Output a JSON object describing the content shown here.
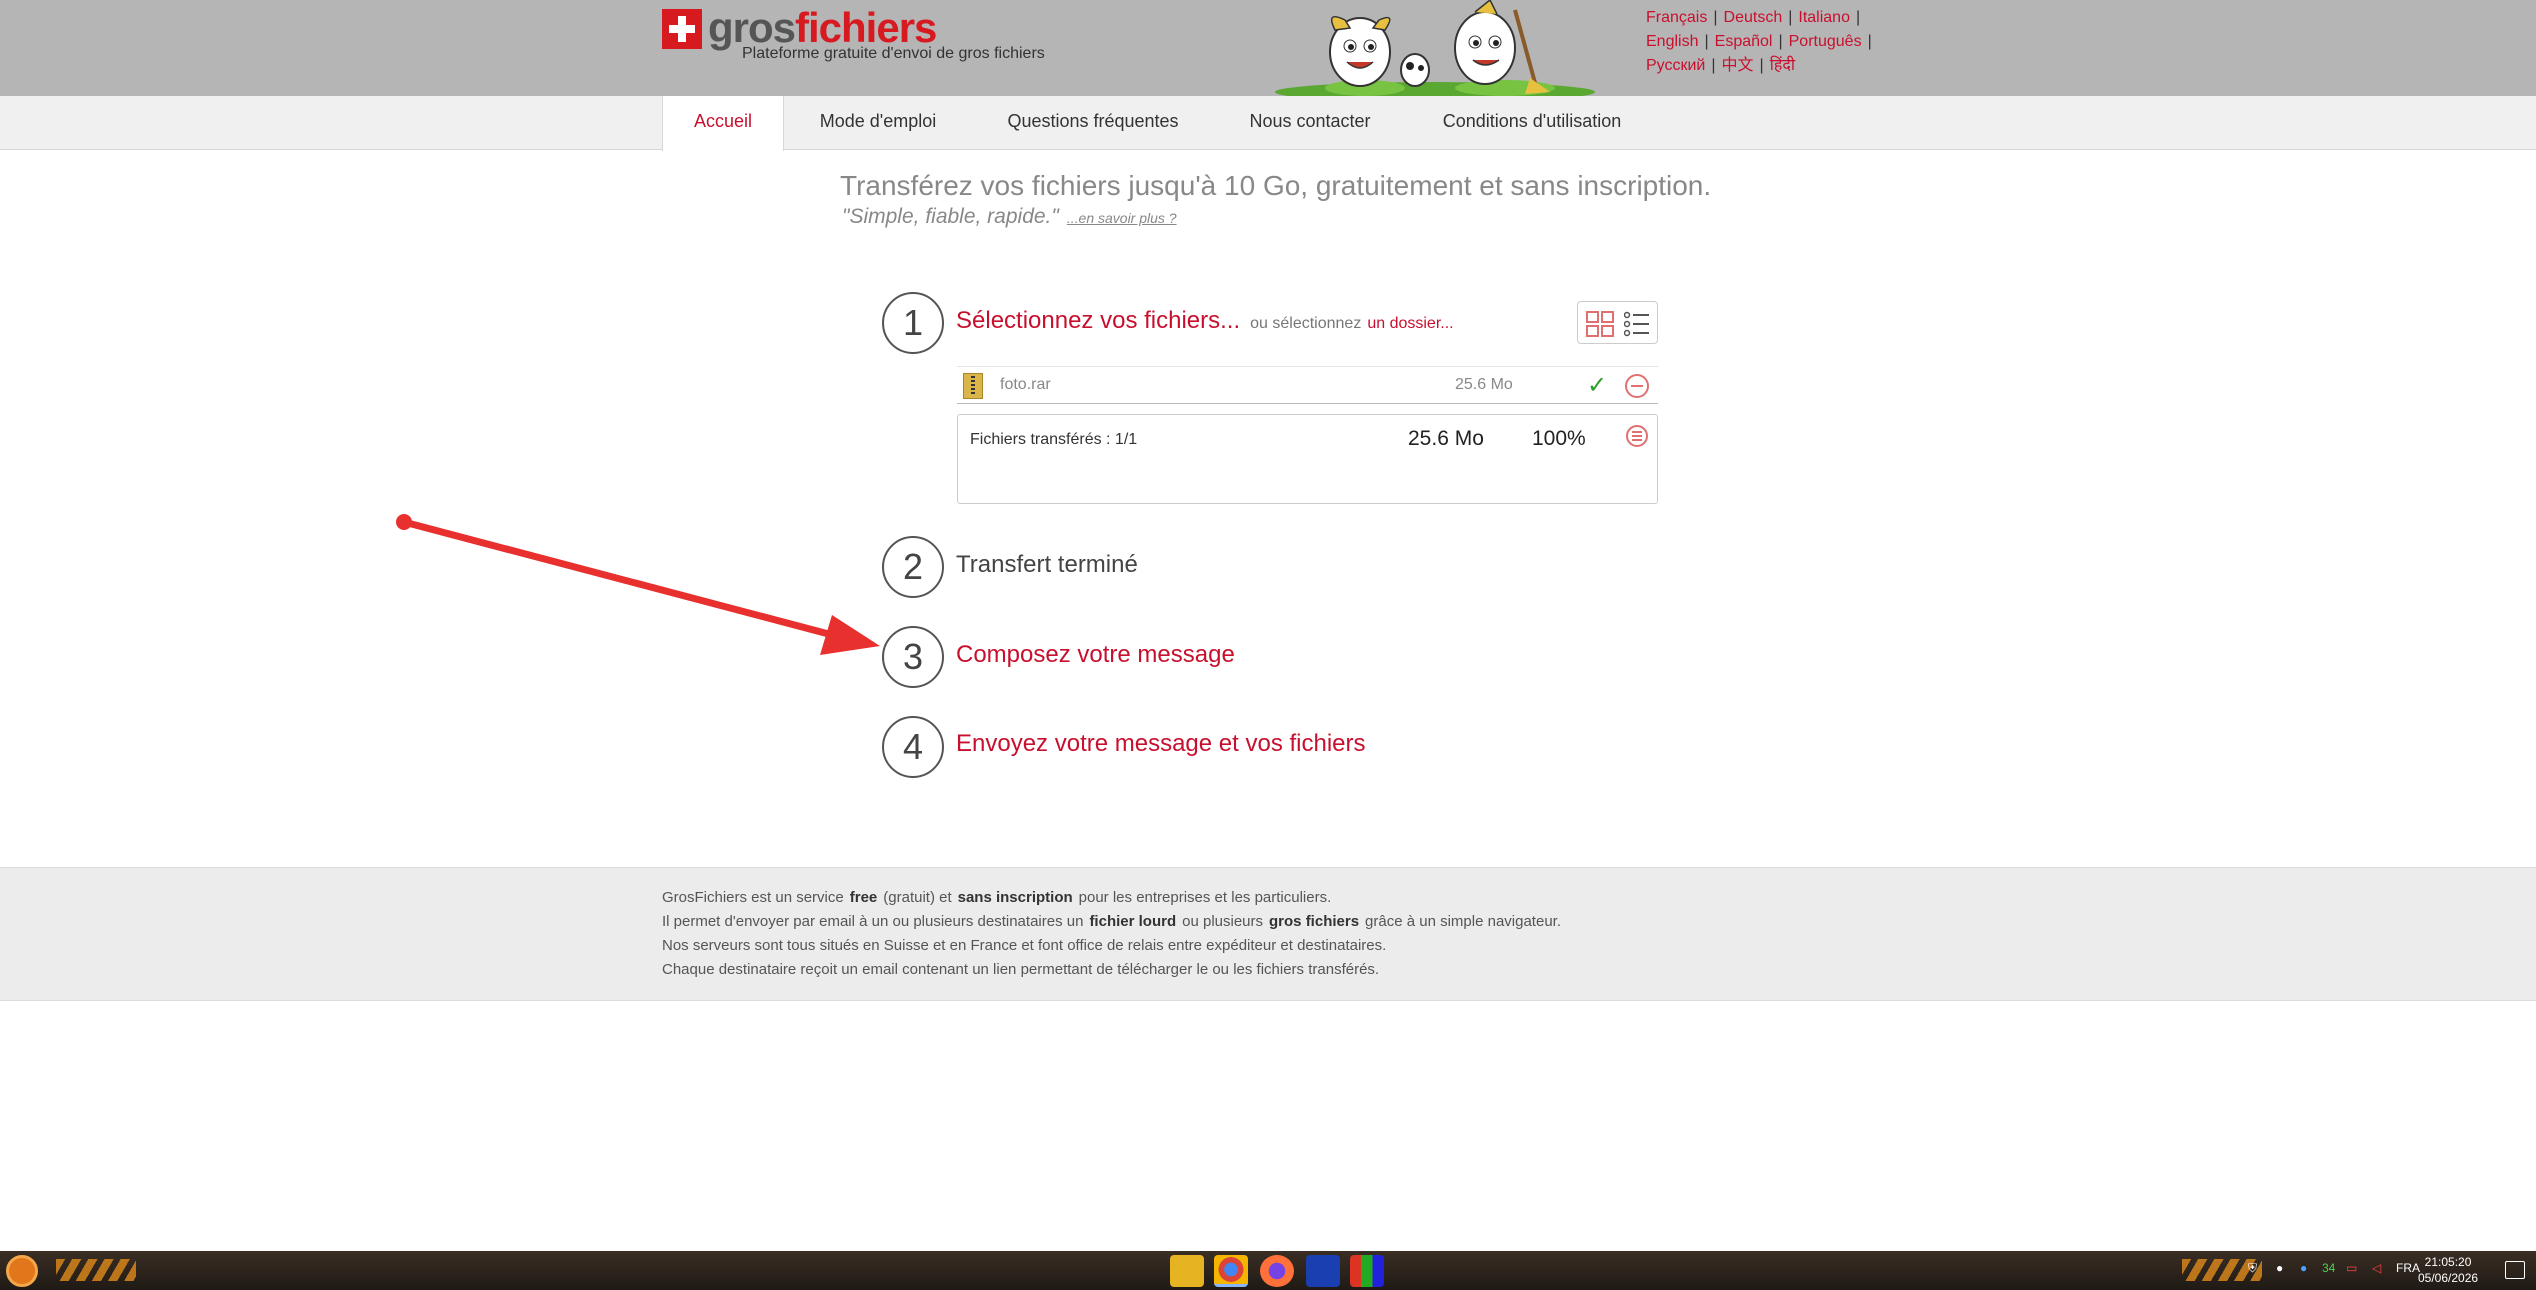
{
  "header": {
    "logo_gros": "gros",
    "logo_fichiers": "fichiers",
    "tagline": "Plateforme gratuite d'envoi de gros fichiers",
    "languages_row1": [
      "Français",
      "Deutsch",
      "Italiano"
    ],
    "languages_row2": [
      "English",
      "Español",
      "Português"
    ],
    "languages_row3": [
      "Русский",
      "中文",
      "हिंदी"
    ]
  },
  "nav": {
    "items": [
      "Accueil",
      "Mode d'emploi",
      "Questions fréquentes",
      "Nous contacter",
      "Conditions d'utilisation"
    ],
    "active": "Accueil"
  },
  "hero": {
    "title": "Transférez vos fichiers jusqu'à 10 Go, gratuitement et sans inscription.",
    "subtitle": "\"Simple, fiable, rapide.\"",
    "more_link": "...en savoir plus ?"
  },
  "steps": {
    "step1": {
      "number": "1",
      "label": "Sélectionnez vos fichiers...",
      "or_text": "ou sélectionnez",
      "folder_link": "un dossier..."
    },
    "step2": {
      "number": "2",
      "label": "Transfert terminé"
    },
    "step3": {
      "number": "3",
      "label": "Composez votre message"
    },
    "step4": {
      "number": "4",
      "label": "Envoyez votre message et vos fichiers"
    }
  },
  "file": {
    "name": "foto.rar",
    "size": "25.6 Mo",
    "status_icon": "check-icon"
  },
  "transfer": {
    "label": "Fichiers transférés : 1/1",
    "total_size": "25.6 Mo",
    "percent": "100%"
  },
  "footer": {
    "line1_a": "GrosFichiers est un service",
    "line1_b": "free",
    "line1_c": "(gratuit) et",
    "line1_d": "sans inscription",
    "line1_e": "pour les entreprises et les particuliers.",
    "line2_a": "Il permet d'envoyer par email à un ou plusieurs destinataires un",
    "line2_b": "fichier lourd",
    "line2_c": "ou plusieurs",
    "line2_d": "gros fichiers",
    "line2_e": "grâce à un simple navigateur.",
    "line3": "Nos serveurs sont tous situés en Suisse et en France et font office de relais entre expéditeur et destinataires.",
    "line4": "Chaque destinataire reçoit un email contenant un lien permettant de télécharger le ou les fichiers transférés."
  },
  "taskbar": {
    "lang": "FRA",
    "time": "21:05:20",
    "date": "05/06/2026",
    "tray_number": "34"
  },
  "colors": {
    "brand_red": "#c8102e",
    "header_gray": "#b5b5b5",
    "success_green": "#2e9d2e"
  }
}
